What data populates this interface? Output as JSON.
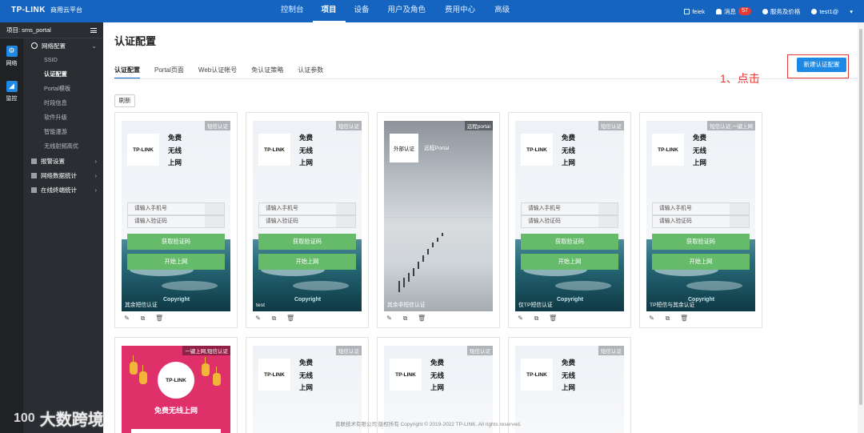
{
  "topbar": {
    "brand": "TP-LINK",
    "brand_sub": "商用云平台",
    "nav": [
      "控制台",
      "项目",
      "设备",
      "用户及角色",
      "费用中心",
      "高级"
    ],
    "user_location": "feiek",
    "messages_label": "消息",
    "messages_count": "57",
    "service_label": "服务及价格",
    "account": "test1@"
  },
  "sidebar": {
    "project": "项目: sms_portal",
    "rail": [
      "网络",
      "监控"
    ],
    "group_network": "网络配置",
    "items": [
      "SSID",
      "认证配置",
      "Portal模板",
      "时段信息",
      "软件升级",
      "智能漫游",
      "无线射频高优"
    ],
    "groups": [
      "报警设置",
      "网络数据统计",
      "在线终端统计"
    ]
  },
  "page": {
    "title": "认证配置",
    "tabs": [
      "认证配置",
      "Portal页面",
      "Web认证帐号",
      "免认证策略",
      "认证参数"
    ],
    "new_button": "新建认证配置",
    "annotation": "1、点击",
    "refresh": "刷新",
    "footer": "普联技术有限公司 版权所有 Copyright © 2019-2022 TP-LINK. All rights reserved."
  },
  "portal_common": {
    "logo_text": "TP-LINK",
    "slogan": [
      "免费",
      "无线",
      "上网"
    ],
    "phone_placeholder": "请输入手机号",
    "code_placeholder": "请输入验证码",
    "get_code": "获取验证码",
    "start": "开始上网",
    "copyright": "Copyright"
  },
  "cards": [
    {
      "tag": "短信认证",
      "label": "其余短信认证"
    },
    {
      "tag": "短信认证",
      "label": "test"
    },
    {
      "tag": "远程portal",
      "label": "其余非短信认证",
      "ext_box": "外部认证",
      "ext_text": "远程Portal"
    },
    {
      "tag": "短信认证",
      "label": "仅TP短信认证"
    },
    {
      "tag": "短信认证,一键上网",
      "label": "TP短信与其余认证"
    }
  ],
  "cards_row2": [
    {
      "tag": "一键上网,短信认证",
      "title": "免费无线上网"
    },
    {
      "tag": "短信认证"
    },
    {
      "tag": "短信认证"
    },
    {
      "tag": "短信认证"
    }
  ],
  "watermark": {
    "logo": "100",
    "text": "大数跨境"
  },
  "colors": {
    "primary": "#1565c0",
    "button": "#1e88e5",
    "green": "#66bb6a",
    "annotation": "#e53935"
  }
}
